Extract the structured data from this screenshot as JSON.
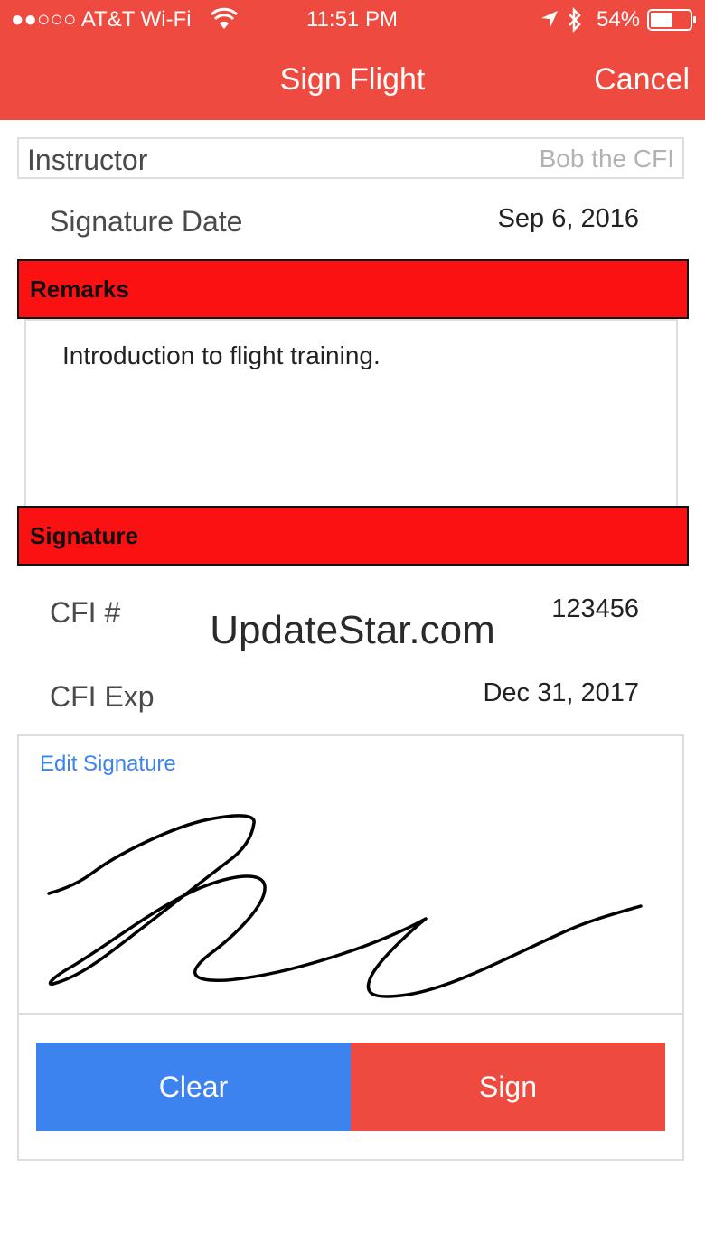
{
  "status_bar": {
    "carrier": "●●○○○ AT&T Wi-Fi",
    "time": "11:51 PM",
    "battery": "54%"
  },
  "nav": {
    "title": "Sign Flight",
    "cancel_label": "Cancel"
  },
  "form": {
    "instructor_label": "Instructor",
    "instructor_placeholder": "Bob the CFI",
    "signature_date_label": "Signature Date",
    "signature_date_value": "Sep 6, 2016",
    "remarks_header": "Remarks",
    "remarks_text": "Introduction to flight training.",
    "signature_header": "Signature",
    "cfi_number_label": "CFI #",
    "cfi_number_value": "123456",
    "cfi_exp_label": "CFI Exp",
    "cfi_exp_value": "Dec 31, 2017"
  },
  "signature_pad": {
    "edit_label": "Edit Signature"
  },
  "buttons": {
    "clear_label": "Clear",
    "sign_label": "Sign"
  },
  "watermark": "UpdateStar.com",
  "colors": {
    "header": "#ef4a3f",
    "section": "#fb1111",
    "clear": "#3d83f0",
    "sign": "#ef4a3f",
    "link": "#3d83f0"
  }
}
